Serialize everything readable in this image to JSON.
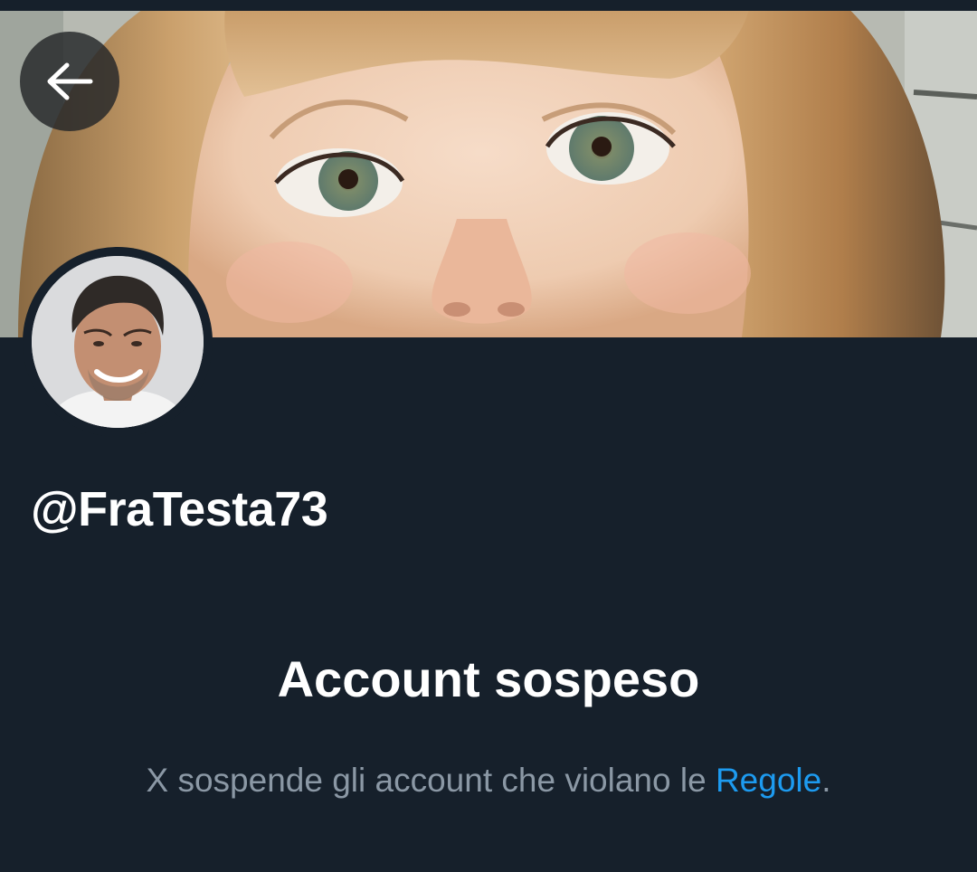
{
  "profile": {
    "handle": "@FraTesta73",
    "banner_description_icon": "banner-photo",
    "avatar_icon": "avatar-photo"
  },
  "header": {
    "back_icon": "arrow-left-icon"
  },
  "suspension": {
    "title": "Account sospeso",
    "message_prefix": "X sospende gli account che violano le ",
    "rules_link": "Regole",
    "message_suffix": "."
  },
  "colors": {
    "background": "#16202b",
    "text_primary": "#ffffff",
    "text_secondary": "#8b98a5",
    "link": "#1d9bf0"
  }
}
